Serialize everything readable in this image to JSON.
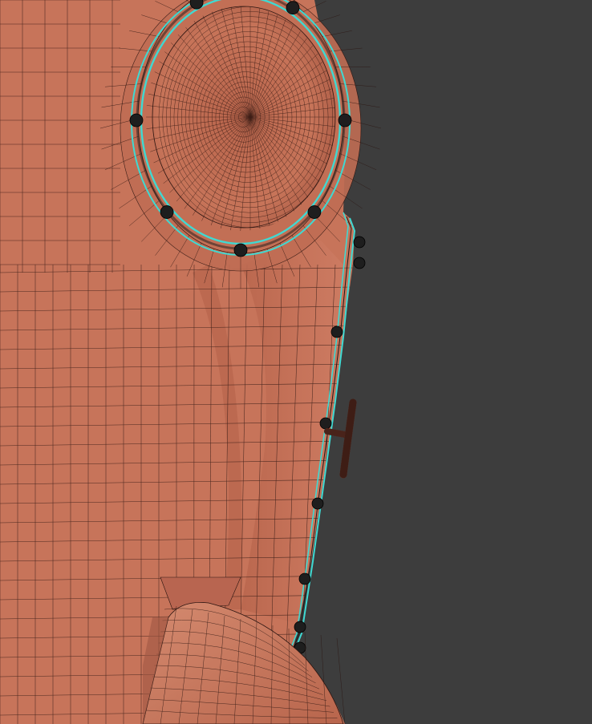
{
  "viewport": {
    "background_color": "#3d3d3d",
    "mesh_base_color": "#c7745a",
    "mesh_shadow_color": "#9e5642",
    "mesh_highlight_color": "#d98a6e",
    "wire_color": "#2a1410",
    "selection_edge_color": "#3fd9d2",
    "bolt_color": "#1e1e1e"
  }
}
